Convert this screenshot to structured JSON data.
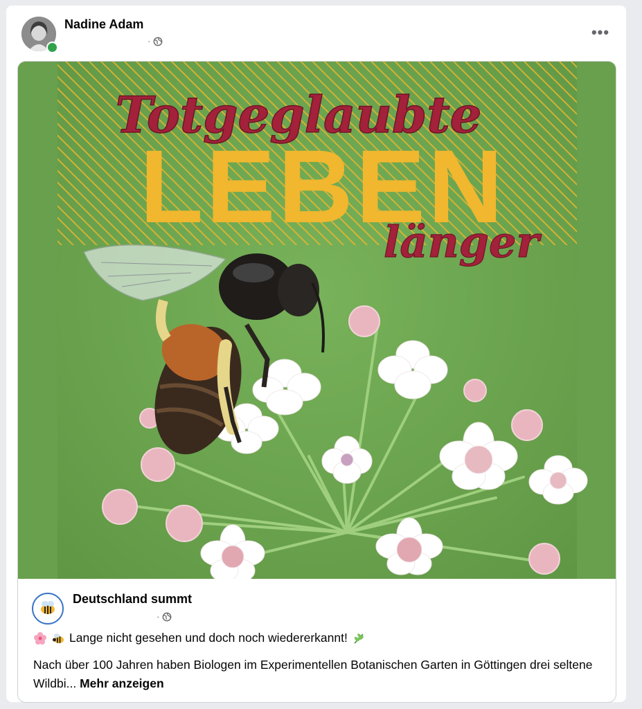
{
  "post": {
    "author_name": "Nadine Adam",
    "meta_separator": "·",
    "more_icon": "•••"
  },
  "image": {
    "title_script": "Totgeglaubte",
    "title_block": "LEBEN",
    "title_script2": "länger",
    "colors": {
      "background": "#68a04d",
      "stripes": "#e6b52f",
      "script": "#a3213a",
      "block": "#f0b72f"
    }
  },
  "shared_post": {
    "page_name": "Deutschland summt",
    "meta_separator": "·",
    "headline": "Lange nicht gesehen und doch noch wiedererkannt!",
    "body": "Nach über 100 Jahren haben Biologen im Experimentellen Botanischen Garten in Göttingen drei seltene Wildbi...",
    "more_label": "Mehr anzeigen"
  },
  "icons": {
    "globe": "globe-icon",
    "flower_emoji": "cherry-blossom-icon",
    "bee_emoji": "bee-icon",
    "herb_emoji": "herb-icon",
    "more": "more-options-icon"
  }
}
